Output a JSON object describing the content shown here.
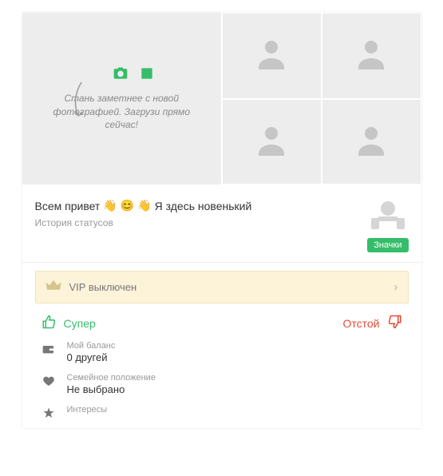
{
  "upload": {
    "hint": "Стань заметнее с новой фотографией. Загрузи прямо сейчас!"
  },
  "status": {
    "part1": "Всем привет",
    "part2": "Я здесь новенький",
    "history": "История статусов"
  },
  "badges": {
    "label": "Значки"
  },
  "vip": {
    "label": "VIP выключен"
  },
  "rating": {
    "good": "Супер",
    "bad": "Отстой"
  },
  "info": {
    "balance": {
      "label": "Мой баланс",
      "value": "0 другей"
    },
    "marital": {
      "label": "Семейное положение",
      "value": "Не выбрано"
    },
    "interests": {
      "label": "Интересы"
    }
  }
}
